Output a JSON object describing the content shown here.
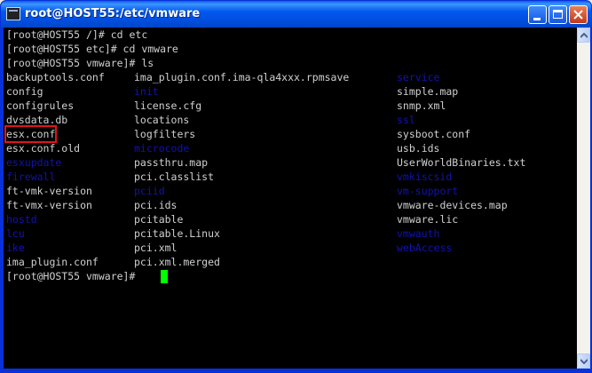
{
  "window": {
    "title": "root@HOST55:/etc/vmware"
  },
  "terminal": {
    "commands": [
      "[root@HOST55 /]# cd etc",
      "[root@HOST55 etc]# cd vmware",
      "[root@HOST55 vmware]# ls"
    ],
    "listing": [
      [
        "backuptools.conf",
        "ima_plugin.conf.ima-qla4xxx.rpmsave",
        "service"
      ],
      [
        "config",
        "init",
        "simple.map"
      ],
      [
        "configrules",
        "license.cfg",
        "snmp.xml"
      ],
      [
        "dvsdata.db",
        "locations",
        "ssl"
      ],
      [
        "esx.conf",
        "logfilters",
        "sysboot.conf"
      ],
      [
        "esx.conf.old",
        "microcode",
        "usb.ids"
      ],
      [
        "esxupdate",
        "passthru.map",
        "UserWorldBinaries.txt"
      ],
      [
        "firewall",
        "pci.classlist",
        "vmkiscsid"
      ],
      [
        "ft-vmk-version",
        "pciid",
        "vm-support"
      ],
      [
        "ft-vmx-version",
        "pci.ids",
        "vmware-devices.map"
      ],
      [
        "hostd",
        "pcitable",
        "vmware.lic"
      ],
      [
        "lcu",
        "pcitable.Linux",
        "vmwauth"
      ],
      [
        "ike",
        "pci.xml",
        "webAccess"
      ],
      [
        "ima_plugin.conf",
        "pci.xml.merged",
        ""
      ]
    ],
    "directories": [
      "service",
      "init",
      "ssl",
      "microcode",
      "esxupdate",
      "firewall",
      "vmkiscsid",
      "pciid",
      "vm-support",
      "hostd",
      "lcu",
      "vmwauth",
      "ike",
      "webAccess"
    ],
    "highlighted": "esx.conf",
    "prompt": "[root@HOST55 vmware]# ",
    "colors": {
      "background": "#000000",
      "text": "#d0d0d0",
      "directory": "#1212b0",
      "cursor": "#00ff00",
      "highlight_box": "#e0141c"
    }
  }
}
